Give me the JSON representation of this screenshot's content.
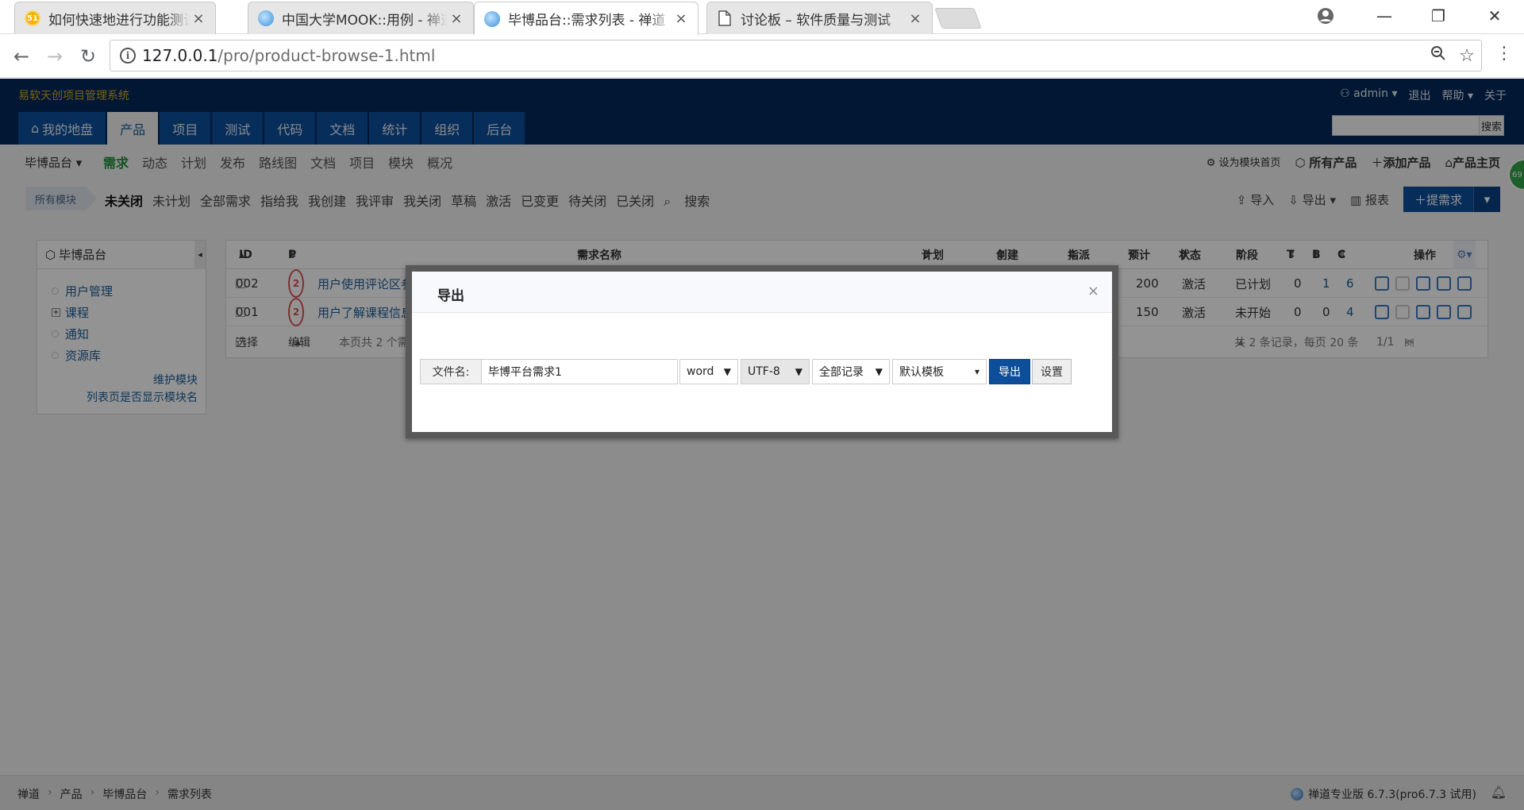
{
  "browser": {
    "tabs": [
      {
        "title": "如何快速地进行功能测试",
        "favicon": "site-51-icon"
      },
      {
        "title": "中国大学MOOK::用例 - 禅道",
        "favicon": "zentao-globe-icon"
      },
      {
        "title": "毕博品台::需求列表 - 禅道",
        "favicon": "zentao-globe-icon",
        "active": true
      },
      {
        "title": "讨论板 – 软件质量与测试",
        "favicon": "document-icon"
      }
    ],
    "url_host": "127.0.0.1",
    "url_path": "/pro/product-browse-1.html"
  },
  "header": {
    "company": "易软天创项目管理系统",
    "user": "admin",
    "logout": "退出",
    "help": "帮助",
    "about": "关于",
    "search_button": "搜索",
    "nav": [
      "我的地盘",
      "产品",
      "项目",
      "测试",
      "代码",
      "文档",
      "统计",
      "组织",
      "后台"
    ],
    "active_nav": "产品"
  },
  "subnav": {
    "product": "毕博品台",
    "items": [
      "需求",
      "动态",
      "计划",
      "发布",
      "路线图",
      "文档",
      "项目",
      "模块",
      "概况"
    ],
    "right": [
      "设为模块首页",
      "所有产品",
      "添加产品",
      "产品主页"
    ]
  },
  "filterbar": {
    "module_tag": "所有模块",
    "filters": [
      "未关闭",
      "未计划",
      "全部需求",
      "指给我",
      "我创建",
      "我评审",
      "我关闭",
      "草稿",
      "激活",
      "已变更",
      "待关闭",
      "已关闭",
      "搜索"
    ],
    "import": "导入",
    "export": "导出",
    "report": "报表",
    "create": "提需求"
  },
  "sidebar": {
    "title": "毕博品台",
    "modules": [
      "用户管理",
      "课程",
      "通知",
      "资源库"
    ],
    "link_maintain": "维护模块",
    "link_show": "列表页是否显示模块名"
  },
  "table": {
    "headers": {
      "id": "ID",
      "pri": "P",
      "name": "需求名称",
      "plan": "计划",
      "creator": "创建",
      "assigned": "指派",
      "estimate": "预计",
      "status": "状态",
      "stage": "阶段",
      "t": "T",
      "b": "B",
      "c": "C",
      "actions": "操作"
    },
    "rows": [
      {
        "id": "002",
        "pri": "2",
        "name": "用户使用评论区参",
        "estimate": "200",
        "status": "激活",
        "stage": "已计划",
        "t": "0",
        "b": "1",
        "c": "6"
      },
      {
        "id": "001",
        "pri": "2",
        "name": "用户了解课程信息",
        "estimate": "150",
        "status": "激活",
        "stage": "未开始",
        "t": "0",
        "b": "0",
        "c": "4"
      }
    ],
    "footer": {
      "select": "选择",
      "edit": "编辑",
      "page_summary": "本页共 2 个需",
      "total": "共 2 条记录，每页 20 条",
      "pages": "1/1"
    }
  },
  "footer": {
    "crumbs": [
      "禅道",
      "产品",
      "毕博品台",
      "需求列表"
    ],
    "version": "禅道专业版 6.7.3(pro6.7.3 试用)",
    "float_badge": "69"
  },
  "modal": {
    "title": "导出",
    "close": "×",
    "filename_label": "文件名:",
    "filename_value": "毕博平台需求1",
    "format": "word",
    "encoding": "UTF-8",
    "range": "全部记录",
    "template": "默认模板",
    "export_button": "导出",
    "settings_button": "设置"
  }
}
